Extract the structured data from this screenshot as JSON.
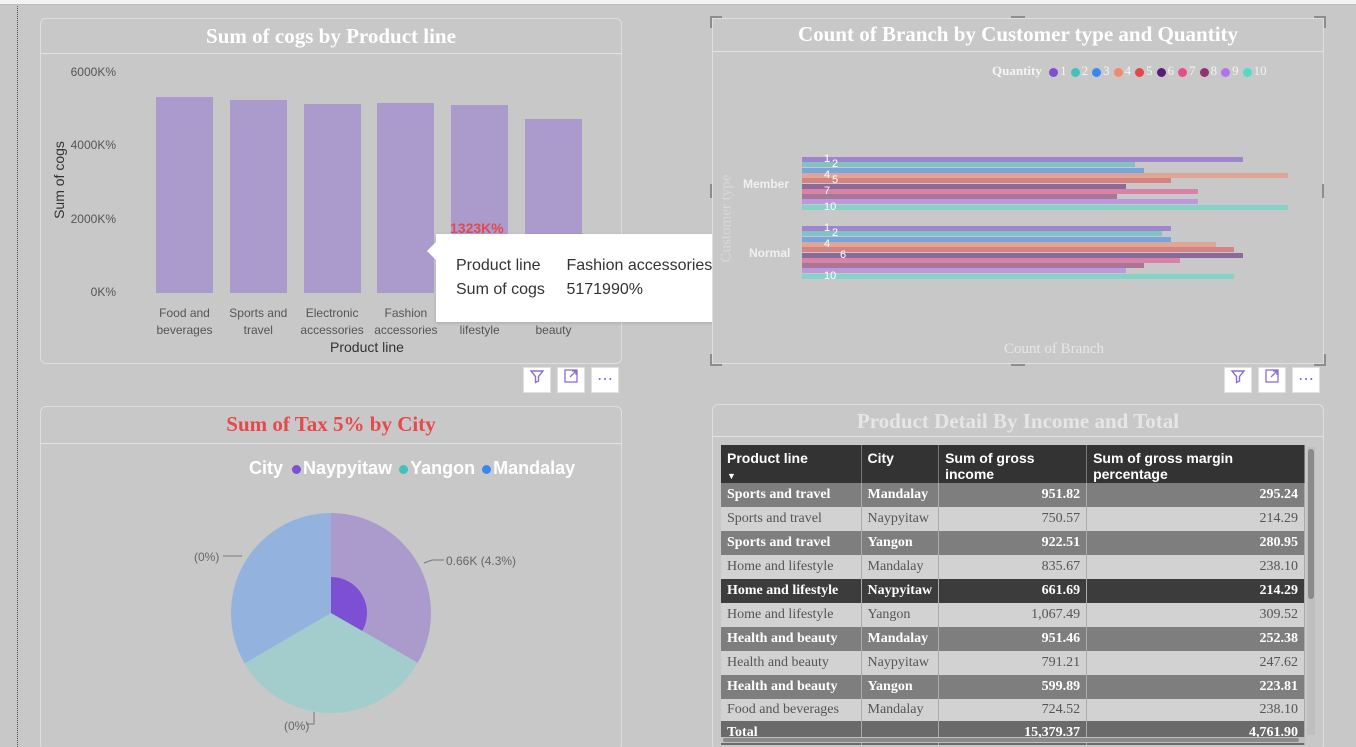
{
  "bar_panel": {
    "title": "Sum of cogs by Product line",
    "tooltip_rows": [
      {
        "key": "Product line",
        "value": "Fashion accessories"
      },
      {
        "key": "Sum of cogs",
        "value": "5171990%"
      }
    ],
    "partial_label": "1323K%"
  },
  "pie_panel": {
    "title": "Sum of Tax 5% by City",
    "legend_title": "City",
    "legend": [
      "Naypyitaw",
      "Yangon",
      "Mandalay"
    ],
    "labels": [
      "(0%)",
      "0.66K (4.3%)",
      "(0%)"
    ]
  },
  "hbar_panel": {
    "title": "Count of Branch by Customer type and Quantity",
    "legend_title": "Quantity",
    "xlabel": "Count of Branch",
    "ylabel": "Customer type"
  },
  "table_panel": {
    "title": "Product Detail By Income and Total",
    "columns": [
      "Product line",
      "City",
      "Sum of gross income",
      "Sum of gross margin percentage"
    ],
    "rows": [
      [
        "Sports and travel",
        "Mandalay",
        "951.82",
        "295.24"
      ],
      [
        "Sports and travel",
        "Naypyitaw",
        "750.57",
        "214.29"
      ],
      [
        "Sports and travel",
        "Yangon",
        "922.51",
        "280.95"
      ],
      [
        "Home and lifestyle",
        "Mandalay",
        "835.67",
        "238.10"
      ],
      [
        "Home and lifestyle",
        "Naypyitaw",
        "661.69",
        "214.29"
      ],
      [
        "Home and lifestyle",
        "Yangon",
        "1,067.49",
        "309.52"
      ],
      [
        "Health and beauty",
        "Mandalay",
        "951.46",
        "252.38"
      ],
      [
        "Health and beauty",
        "Naypyitaw",
        "791.21",
        "247.62"
      ],
      [
        "Health and beauty",
        "Yangon",
        "599.89",
        "223.81"
      ],
      [
        "Food and beverages",
        "Mandalay",
        "724.52",
        "238.10"
      ]
    ],
    "total": [
      "Total",
      "",
      "15,379.37",
      "4,761.90"
    ]
  },
  "colors": {
    "bar": "#ab9bcc",
    "pie_naypyitaw": "#ab9bcc",
    "pie_yangon": "#a3cccc",
    "pie_mandalay": "#94b2de",
    "accent_red": "#e8484a"
  },
  "chart_data": [
    {
      "type": "bar",
      "title": "Sum of cogs by Product line",
      "xlabel": "Product line",
      "ylabel": "Sum of cogs",
      "categories": [
        "Food and beverages",
        "Sports and travel",
        "Electronic accessories",
        "Fashion accessories",
        "lifestyle",
        "beauty"
      ],
      "values": [
        5351,
        5263,
        5168,
        5172,
        5124,
        4743
      ],
      "yticks": [
        "0K%",
        "2000K%",
        "4000K%",
        "6000K%"
      ],
      "ylim": [
        0,
        6000
      ],
      "unit": "K%"
    },
    {
      "type": "bar",
      "orientation": "horizontal",
      "title": "Count of Branch by Customer type and Quantity",
      "categories": [
        "Member",
        "Normal"
      ],
      "legend_title": "Quantity",
      "series": [
        {
          "name": "1",
          "color": "#7d4fd3",
          "values": [
            49,
            41
          ]
        },
        {
          "name": "2",
          "color": "#43c1bd",
          "values": [
            37,
            40
          ]
        },
        {
          "name": "3",
          "color": "#3b86f2",
          "values": [
            38,
            41
          ]
        },
        {
          "name": "4",
          "color": "#f08a6b",
          "values": [
            54,
            46
          ]
        },
        {
          "name": "5",
          "color": "#e24848",
          "values": [
            41,
            48
          ]
        },
        {
          "name": "6",
          "color": "#5a1e76",
          "values": [
            36,
            49
          ]
        },
        {
          "name": "7",
          "color": "#e64b8b",
          "values": [
            44,
            42
          ]
        },
        {
          "name": "8",
          "color": "#8e356f",
          "values": [
            35,
            38
          ]
        },
        {
          "name": "9",
          "color": "#b373ec",
          "values": [
            44,
            36
          ]
        },
        {
          "name": "10",
          "color": "#4fdcc6",
          "values": [
            54,
            48
          ]
        }
      ]
    },
    {
      "type": "pie",
      "title": "Sum of Tax 5% by City",
      "labels": [
        "Naypyitaw",
        "Yangon",
        "Mandalay"
      ],
      "values": [
        33.3,
        33.3,
        33.4
      ]
    }
  ]
}
